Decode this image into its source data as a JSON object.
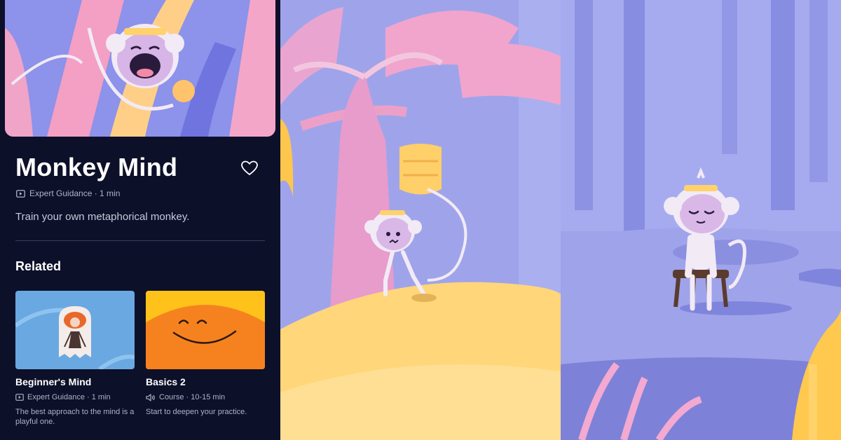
{
  "detail": {
    "title": "Monkey Mind",
    "meta": "Expert Guidance · 1 min",
    "description": "Train your own metaphorical monkey."
  },
  "related": {
    "heading": "Related",
    "cards": [
      {
        "title": "Beginner's Mind",
        "meta": "Expert Guidance · 1 min",
        "description": "The best approach to the mind is a playful one.",
        "meta_icon": "video-icon"
      },
      {
        "title": "Basics 2",
        "meta": "Course · 10-15 min",
        "description": "Start to deepen your practice.",
        "meta_icon": "speaker-icon"
      }
    ]
  },
  "icons": {
    "favorite": "heart-icon",
    "content_type": "video-icon"
  },
  "colors": {
    "panel_background": "#0d1029",
    "accent_orange": "#f6821f",
    "accent_yellow": "#ffc21a",
    "scene_purple": "#9fa4ea"
  }
}
